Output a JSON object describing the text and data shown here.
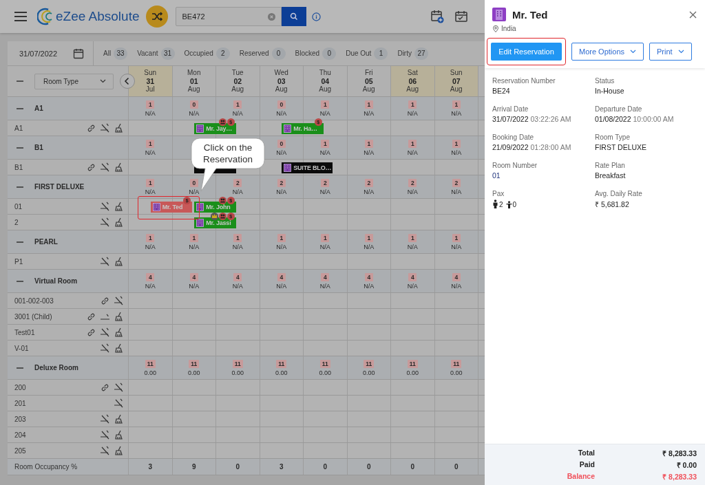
{
  "topbar": {
    "logo_text": "eZee Absolute",
    "search": {
      "value": "BE472"
    }
  },
  "date_picker": {
    "value": "31/07/2022"
  },
  "filters": [
    {
      "label": "All",
      "count": "33"
    },
    {
      "label": "Vacant",
      "count": "31"
    },
    {
      "label": "Occupied",
      "count": "2"
    },
    {
      "label": "Reserved",
      "count": "0"
    },
    {
      "label": "Blocked",
      "count": "0"
    },
    {
      "label": "Due Out",
      "count": "1"
    },
    {
      "label": "Dirty",
      "count": "27"
    }
  ],
  "grid": {
    "room_type_select": "Room Type",
    "days": [
      {
        "weekday": "Sun",
        "day": "31",
        "month": "Jul",
        "weekend": true
      },
      {
        "weekday": "Mon",
        "day": "01",
        "month": "Aug",
        "weekend": false
      },
      {
        "weekday": "Tue",
        "day": "02",
        "month": "Aug",
        "weekend": false
      },
      {
        "weekday": "Wed",
        "day": "03",
        "month": "Aug",
        "weekend": false
      },
      {
        "weekday": "Thu",
        "day": "04",
        "month": "Aug",
        "weekend": false
      },
      {
        "weekday": "Fri",
        "day": "05",
        "month": "Aug",
        "weekend": false
      },
      {
        "weekday": "Sat",
        "day": "06",
        "month": "Aug",
        "weekend": true
      },
      {
        "weekday": "Sun",
        "day": "07",
        "month": "Aug",
        "weekend": true
      }
    ],
    "groups": [
      {
        "name": "A1",
        "cells": [
          {
            "kind": "count",
            "count": "1",
            "rate": "N/A"
          },
          {
            "kind": "count",
            "count": "0",
            "rate": "N/A"
          },
          {
            "kind": "count",
            "count": "1",
            "rate": "N/A"
          },
          {
            "kind": "count",
            "count": "0",
            "rate": "N/A"
          },
          {
            "kind": "count",
            "count": "1",
            "rate": "N/A"
          },
          {
            "kind": "count",
            "count": "1",
            "rate": "N/A"
          },
          {
            "kind": "count",
            "count": "1",
            "rate": "N/A"
          },
          {
            "kind": "count",
            "count": "1",
            "rate": "N/A"
          }
        ],
        "rooms": [
          {
            "name": "A1",
            "icons": [
              {
                "kind": "link"
              },
              {
                "kind": "cross"
              },
              {
                "kind": "clean"
              }
            ],
            "timeline": [
              {
                "kind": "free"
              },
              {
                "kind": "booking",
                "label": "Mr. Jay…",
                "color": "#1a8f1a",
                "badges": [
                  {
                    "kind": "group"
                  },
                  {
                    "kind": "dollar",
                    "text": "$"
                  }
                ]
              },
              {
                "kind": "free"
              },
              {
                "kind": "booking",
                "label": "Mr. Ha…",
                "color": "#1a8f1a",
                "badges": [
                  {
                    "kind": "dollar",
                    "text": "$"
                  }
                ]
              },
              {
                "kind": "free"
              },
              {
                "kind": "free"
              },
              {
                "kind": "free"
              },
              {
                "kind": "free"
              }
            ]
          }
        ]
      },
      {
        "name": "B1",
        "cells": [
          {
            "kind": "count",
            "count": "1",
            "rate": "N/A"
          },
          {
            "kind": "covered"
          },
          {
            "kind": "covered"
          },
          {
            "kind": "count",
            "count": "0",
            "rate": "N/A"
          },
          {
            "kind": "count",
            "count": "1",
            "rate": "N/A"
          },
          {
            "kind": "count",
            "count": "1",
            "rate": "N/A"
          },
          {
            "kind": "count",
            "count": "1",
            "rate": "N/A"
          },
          {
            "kind": "count",
            "count": "1",
            "rate": "N/A"
          }
        ],
        "rooms": [
          {
            "name": "B1",
            "icons": [
              {
                "kind": "link"
              },
              {
                "kind": "cross"
              },
              {
                "kind": "clean"
              }
            ],
            "timeline": [
              {
                "kind": "free"
              },
              {
                "kind": "booking",
                "color": "#0a0a0a"
              },
              {
                "kind": "free"
              },
              {
                "kind": "booking",
                "label": "SUITE BLO…",
                "color": "#0a0a0a"
              },
              {
                "kind": "free"
              },
              {
                "kind": "free"
              },
              {
                "kind": "free"
              },
              {
                "kind": "free"
              }
            ]
          }
        ]
      },
      {
        "name": "FIRST DELUXE",
        "cells": [
          {
            "kind": "count",
            "count": "1",
            "rate": "N/A"
          },
          {
            "kind": "count",
            "count": "0",
            "rate": "N/A"
          },
          {
            "kind": "count",
            "count": "2",
            "rate": "N/A"
          },
          {
            "kind": "count",
            "count": "2",
            "rate": "N/A"
          },
          {
            "kind": "count",
            "count": "2",
            "rate": "N/A"
          },
          {
            "kind": "count",
            "count": "2",
            "rate": "N/A"
          },
          {
            "kind": "count",
            "count": "2",
            "rate": "N/A"
          },
          {
            "kind": "count",
            "count": "2",
            "rate": "N/A"
          }
        ],
        "rooms": [
          {
            "name": "01",
            "icons": [
              {
                "kind": "cross"
              },
              {
                "kind": "clean"
              }
            ],
            "timeline": [
              {
                "kind": "booking",
                "label": "Mr. Ted",
                "color": "#c85858",
                "badges": [
                  {
                    "kind": "dollar",
                    "text": "$"
                  }
                ]
              },
              {
                "kind": "booking",
                "label": "Mr. John",
                "color": "#1a8f1a",
                "badges": [
                  {
                    "kind": "group"
                  },
                  {
                    "kind": "dollar",
                    "text": "$"
                  }
                ]
              },
              {
                "kind": "free"
              },
              {
                "kind": "free"
              },
              {
                "kind": "free"
              },
              {
                "kind": "free"
              },
              {
                "kind": "free"
              },
              {
                "kind": "free"
              }
            ]
          },
          {
            "name": "2",
            "icons": [
              {
                "kind": "cross"
              },
              {
                "kind": "clean"
              }
            ],
            "timeline": [
              {
                "kind": "free"
              },
              {
                "kind": "booking",
                "label": "Mr. Jassi",
                "color": "#1a8f1a",
                "badges": [
                  {
                    "kind": "crown"
                  },
                  {
                    "kind": "group"
                  },
                  {
                    "kind": "dollar",
                    "text": "$"
                  }
                ]
              },
              {
                "kind": "free"
              },
              {
                "kind": "free"
              },
              {
                "kind": "free"
              },
              {
                "kind": "free"
              },
              {
                "kind": "free"
              },
              {
                "kind": "free"
              }
            ]
          }
        ]
      },
      {
        "name": "PEARL",
        "cells": [
          {
            "kind": "count",
            "count": "1",
            "rate": "N/A"
          },
          {
            "kind": "count",
            "count": "1",
            "rate": "N/A"
          },
          {
            "kind": "count",
            "count": "1",
            "rate": "N/A"
          },
          {
            "kind": "count",
            "count": "1",
            "rate": "N/A"
          },
          {
            "kind": "count",
            "count": "1",
            "rate": "N/A"
          },
          {
            "kind": "count",
            "count": "1",
            "rate": "N/A"
          },
          {
            "kind": "count",
            "count": "1",
            "rate": "N/A"
          },
          {
            "kind": "count",
            "count": "1",
            "rate": "N/A"
          }
        ],
        "rooms": [
          {
            "name": "P1",
            "icons": [
              {
                "kind": "cross"
              },
              {
                "kind": "clean"
              }
            ]
          }
        ]
      },
      {
        "name": "Virtual Room",
        "cells": [
          {
            "kind": "count",
            "count": "4",
            "rate": "N/A"
          },
          {
            "kind": "count",
            "count": "4",
            "rate": "N/A"
          },
          {
            "kind": "count",
            "count": "4",
            "rate": "N/A"
          },
          {
            "kind": "count",
            "count": "4",
            "rate": "N/A"
          },
          {
            "kind": "count",
            "count": "4",
            "rate": "N/A"
          },
          {
            "kind": "count",
            "count": "4",
            "rate": "N/A"
          },
          {
            "kind": "count",
            "count": "4",
            "rate": "N/A"
          },
          {
            "kind": "count",
            "count": "4",
            "rate": "N/A"
          }
        ],
        "rooms": [
          {
            "name": "001-002-003",
            "icons": [
              {
                "kind": "link"
              },
              {
                "kind": "cross"
              }
            ]
          },
          {
            "name": "3001 (Child)",
            "icons": [
              {
                "kind": "link"
              },
              {
                "kind": "flat"
              },
              {
                "kind": "clean"
              }
            ]
          },
          {
            "name": "Test01",
            "icons": [
              {
                "kind": "link"
              },
              {
                "kind": "cross"
              },
              {
                "kind": "clean"
              }
            ]
          },
          {
            "name": "V-01",
            "icons": [
              {
                "kind": "cross"
              },
              {
                "kind": "clean"
              }
            ]
          }
        ]
      },
      {
        "name": "Deluxe Room",
        "cells": [
          {
            "kind": "count",
            "count": "11",
            "rate": "0.00"
          },
          {
            "kind": "count",
            "count": "11",
            "rate": "0.00"
          },
          {
            "kind": "count",
            "count": "11",
            "rate": "0.00"
          },
          {
            "kind": "count",
            "count": "11",
            "rate": "0.00"
          },
          {
            "kind": "count",
            "count": "11",
            "rate": "0.00"
          },
          {
            "kind": "count",
            "count": "11",
            "rate": "0.00"
          },
          {
            "kind": "count",
            "count": "11",
            "rate": "0.00"
          },
          {
            "kind": "count",
            "count": "11",
            "rate": "0.00"
          }
        ],
        "rooms": [
          {
            "name": "200",
            "icons": [
              {
                "kind": "link"
              },
              {
                "kind": "cross"
              }
            ]
          },
          {
            "name": "201",
            "icons": [
              {
                "kind": "cross"
              }
            ]
          },
          {
            "name": "203",
            "icons": [
              {
                "kind": "cross"
              },
              {
                "kind": "clean"
              }
            ]
          },
          {
            "name": "204",
            "icons": [
              {
                "kind": "cross"
              },
              {
                "kind": "clean"
              }
            ]
          },
          {
            "name": "205",
            "icons": [
              {
                "kind": "cross"
              },
              {
                "kind": "clean"
              }
            ]
          }
        ]
      }
    ],
    "occupancy": {
      "label": "Room Occupancy %",
      "values": [
        "3",
        "9",
        "0",
        "3",
        "0",
        "0",
        "0",
        "0"
      ]
    }
  },
  "callout": {
    "lines": [
      "Click on the",
      "Reservation"
    ]
  },
  "panel": {
    "guest": "Mr. Ted",
    "location": "India",
    "buttons": [
      {
        "label": "Edit Reservation",
        "kind": "primary",
        "highlighted": true
      },
      {
        "label": "More Options",
        "kind": "dropdown",
        "highlighted": false
      },
      {
        "label": "Print",
        "kind": "dropdown",
        "highlighted": false
      }
    ],
    "details": [
      {
        "label": "Reservation Number",
        "kind": "text",
        "value": "BE24"
      },
      {
        "label": "Status",
        "kind": "text",
        "value": "In-House"
      },
      {
        "label": "Arrival Date",
        "kind": "datetime",
        "value": "31/07/2022",
        "time": "03:22:26 AM"
      },
      {
        "label": "Departure Date",
        "kind": "datetime",
        "value": "01/08/2022",
        "time": "10:00:00 AM"
      },
      {
        "label": "Booking Date",
        "kind": "datetime",
        "value": "21/09/2022",
        "time": "01:28:00 AM"
      },
      {
        "label": "Room Type",
        "kind": "text",
        "value": "FIRST DELUXE"
      },
      {
        "label": "Room Number",
        "kind": "link",
        "value": "01"
      },
      {
        "label": "Rate Plan",
        "kind": "text",
        "value": "Breakfast"
      },
      {
        "label": "Pax",
        "kind": "pax",
        "adults": "2",
        "children": "0"
      },
      {
        "label": "Avg. Daily Rate",
        "kind": "text",
        "value": "₹ 5,681.82"
      }
    ],
    "totals": [
      {
        "label": "Total",
        "value": "₹ 8,283.33",
        "kind": "normal"
      },
      {
        "label": "Paid",
        "value": "₹ 0.00",
        "kind": "normal"
      },
      {
        "label": "Balance",
        "value": "₹ 8,283.33",
        "kind": "due"
      }
    ]
  }
}
